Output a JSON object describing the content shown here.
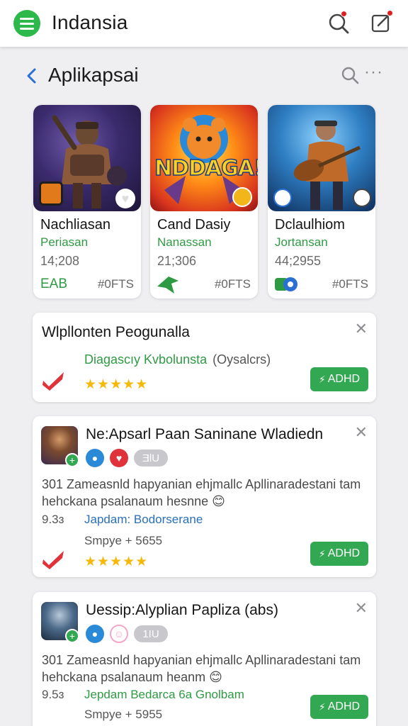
{
  "appbar": {
    "title": "Indansia",
    "icons": [
      "menu-logo",
      "search-icon",
      "edit-icon"
    ],
    "accent": "#2db84c"
  },
  "section": {
    "title": "Aplikapsai",
    "back_icon": "chevron-left-icon",
    "more": "···"
  },
  "cards": [
    {
      "name": "Nachliasan",
      "developer": "Periasan",
      "count": "14;208",
      "badge": "EAB",
      "price": "#0FTS"
    },
    {
      "name": "Cand Dasiy",
      "developer": "Nanassan",
      "count": "21;306",
      "badge": "",
      "price": "#0FTS",
      "banner": "NDDAGA!"
    },
    {
      "name": "Dclaulhiom",
      "developer": "Jortansan",
      "count": "44;2955",
      "badge": "",
      "price": "#0FTS"
    }
  ],
  "panels": {
    "promo": {
      "title": "Wlpllonten Peogunalla",
      "subtitle": "Diagascıy Kvbolunsta",
      "subtitle_extra": "(Oysalcrs)",
      "stars": "★★★★★",
      "button": "ADHD"
    },
    "item1": {
      "title": "Ne:Apsarl Paan Saninane Wladiedn",
      "chip_pill": "ƎlU",
      "description": "301 Zameasnld hapyanian ehjmallc Apllinaradestani tam hehckana psalanaum hesnne 😊",
      "number": "9.3ɜ",
      "link": "Japdam: Bodorserane",
      "meta": "Smpye + 5655",
      "stars": "★★★★★",
      "button": "ADHD"
    },
    "item2": {
      "title": "Uessip:Alyplian Papliza (abs)",
      "chip_pill": "1IU",
      "description": "301 Zameasnld hapyanian ehjmallc Apllinaradestani tam hehckana psalanaum heanm 😊",
      "number": "9.5ɜ",
      "link": "Jepdam Bedarca 6a Gnolbam",
      "meta": "Smpye + 5955",
      "button": "ADHD"
    }
  }
}
